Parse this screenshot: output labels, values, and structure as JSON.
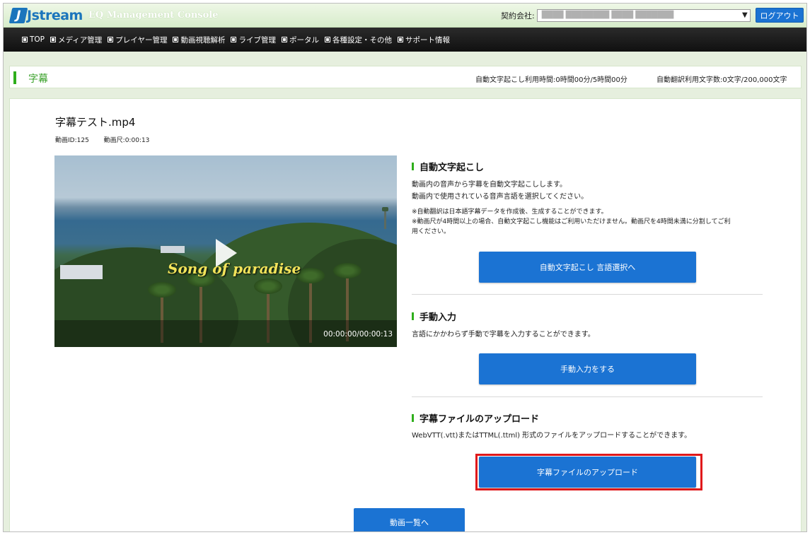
{
  "header": {
    "logo_text": "Jstream",
    "logo_mark": "J",
    "console_title": "EQ Management Console",
    "contract_label": "契約会社:",
    "contract_value": "████ ████████ ████ ███████",
    "logout_label": "ログアウト"
  },
  "nav": {
    "items": [
      {
        "label": "TOP"
      },
      {
        "label": "メディア管理"
      },
      {
        "label": "プレイヤー管理"
      },
      {
        "label": "動画視聴解析"
      },
      {
        "label": "ライブ管理"
      },
      {
        "label": "ポータル"
      },
      {
        "label": "各種設定・その他"
      },
      {
        "label": "サポート情報"
      }
    ]
  },
  "page": {
    "title": "字幕",
    "usage_transcription": "自動文字起こし利用時間:0時間00分/5時間00分",
    "usage_translation": "自動翻訳利用文字数:0文字/200,000文字"
  },
  "video": {
    "file_name": "字幕テスト.mp4",
    "id_text": "動画ID:125",
    "duration_text": "動画尺:0:00:13",
    "overlay_title": "Song of paradise",
    "timecode": "00:00:00/00:00:13"
  },
  "sections": {
    "auto": {
      "heading": "自動文字起こし",
      "desc1": "動画内の音声から字幕を自動文字起こしします。",
      "desc2": "動画内で使用されている音声言語を選択してください。",
      "note1": "※自動翻訳は日本語字幕データを作成後、生成することができます。",
      "note2": "※動画尺が4時間以上の場合、自動文字起こし機能はご利用いただけません。動画尺を4時間未満に分割してご利",
      "note3": "用ください。",
      "button": "自動文字起こし 言語選択へ"
    },
    "manual": {
      "heading": "手動入力",
      "desc": "言語にかかわらず手動で字幕を入力することができます。",
      "button": "手動入力をする"
    },
    "upload": {
      "heading": "字幕ファイルのアップロード",
      "desc": "WebVTT(.vtt)またはTTML(.ttml) 形式のファイルをアップロードすることができます。",
      "button": "字幕ファイルのアップロード"
    }
  },
  "footer": {
    "back_button": "動画一覧へ"
  },
  "colors": {
    "accent_green": "#2fae1c",
    "button_blue": "#1b73d3",
    "highlight_red": "#e0191b"
  }
}
